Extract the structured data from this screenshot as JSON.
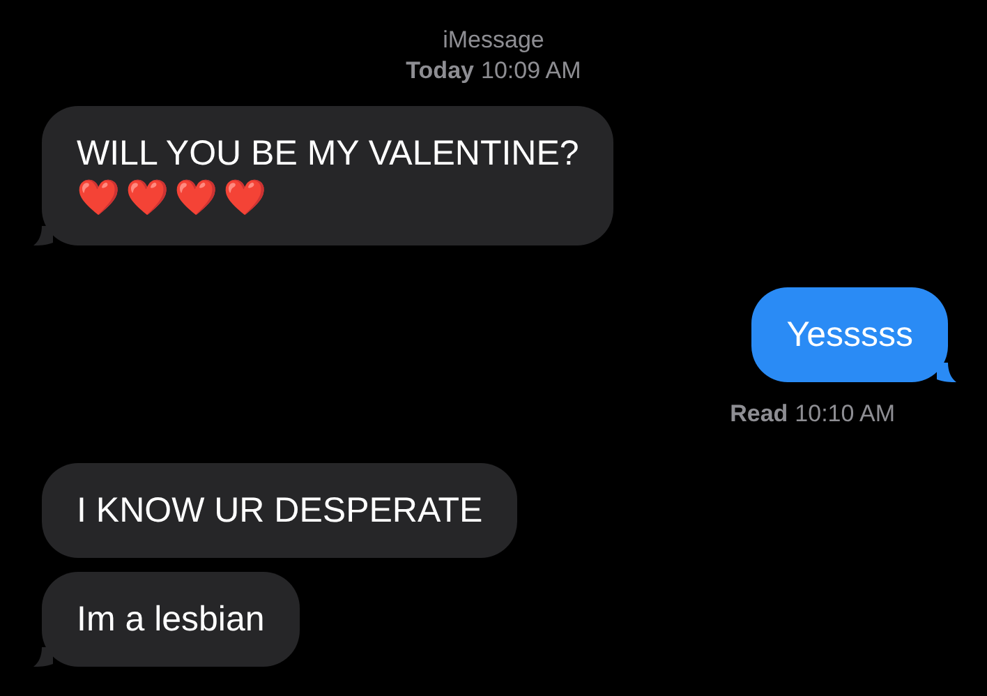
{
  "header": {
    "service": "iMessage",
    "day": "Today",
    "time": "10:09 AM"
  },
  "messages": [
    {
      "kind": "incoming",
      "tail": true,
      "lines": [
        "WILL YOU BE MY VALENTINE?",
        "❤️❤️❤️❤️"
      ]
    },
    {
      "kind": "outgoing",
      "tail": true,
      "lines": [
        "Yesssss"
      ]
    },
    {
      "kind": "receipt",
      "status": "Read",
      "time": "10:10 AM"
    },
    {
      "kind": "incoming",
      "tail": false,
      "lines": [
        "I KNOW UR DESPERATE"
      ]
    },
    {
      "kind": "incoming",
      "tail": true,
      "lines": [
        "Im a lesbian"
      ]
    }
  ]
}
